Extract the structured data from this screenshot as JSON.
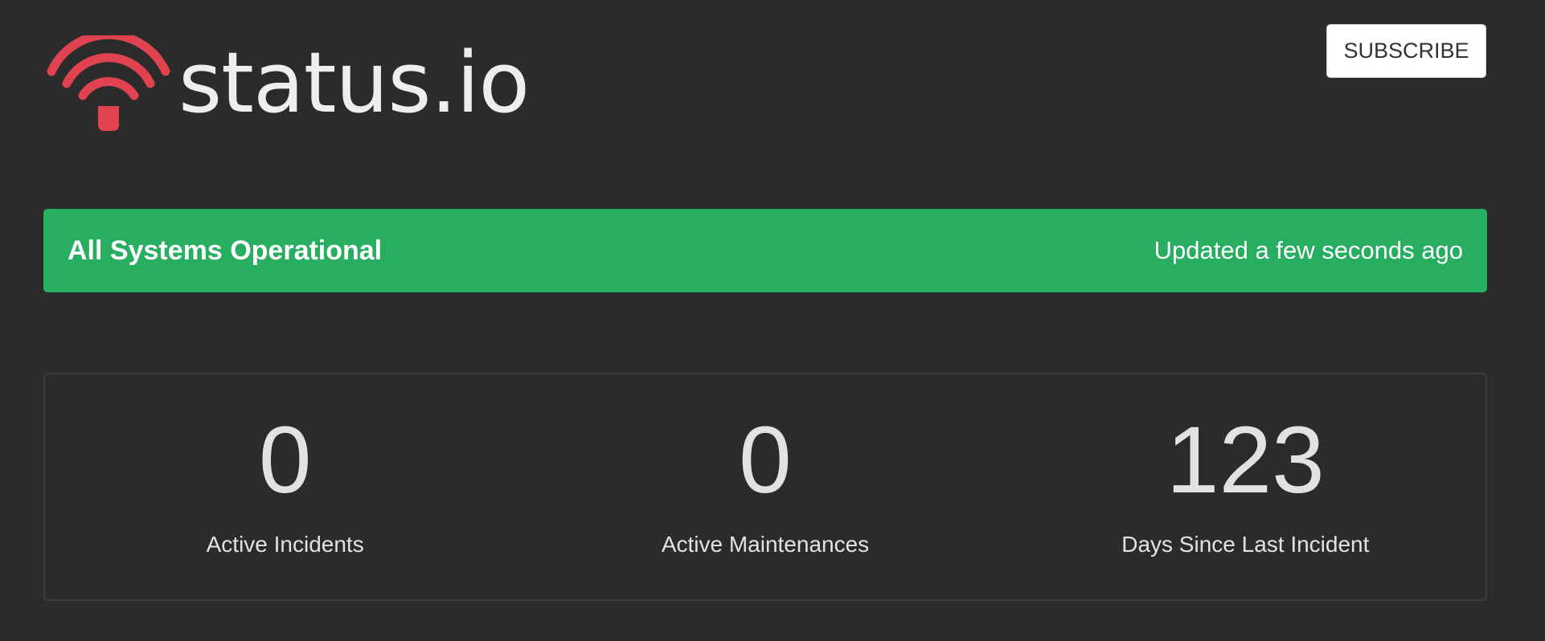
{
  "header": {
    "logo_text": "status.io",
    "logo_icon": "wifi-signal-icon",
    "subscribe_label": "SUBSCRIBE"
  },
  "status_banner": {
    "title": "All Systems Operational",
    "updated": "Updated a few seconds ago",
    "color": "#27ae60"
  },
  "stats": [
    {
      "value": "0",
      "label": "Active Incidents"
    },
    {
      "value": "0",
      "label": "Active Maintenances"
    },
    {
      "value": "123",
      "label": "Days Since Last Incident"
    }
  ],
  "colors": {
    "background": "#2b2b2b",
    "brand_red": "#e0434f"
  }
}
